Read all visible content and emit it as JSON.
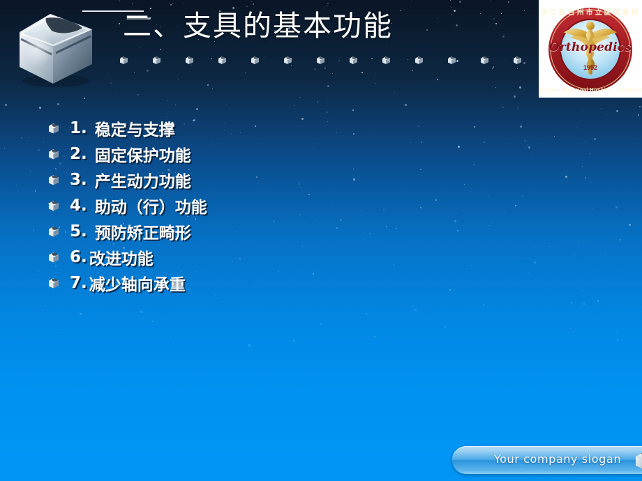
{
  "slide": {
    "title": "二、支具的基本功能",
    "background": {
      "top_color": "#0a1526",
      "bottom_color": "#0095f5",
      "accent_color": "#0671c4"
    }
  },
  "header": {
    "rule_icon": "horizontal-rule",
    "hero_icon": "chrome-cube",
    "decor_icon": "mini-cube",
    "decor_count": 13
  },
  "logo": {
    "word": "Orthopedics",
    "year": "1952",
    "arc_top": "浙江省台州市立医院骨科",
    "arc_bottom": "Taizhou Municipal Hospital · Zhejiang",
    "emblem_icon": "caduceus-icon",
    "ring_color": "#a01c22",
    "text_color": "#8d1219"
  },
  "bullets": {
    "icon": "cube-bullet-icon",
    "items": [
      {
        "num": "1.",
        "text": "稳定与支撑"
      },
      {
        "num": "2.",
        "text": "固定保护功能"
      },
      {
        "num": "3.",
        "text": "产生动力功能"
      },
      {
        "num": "4.",
        "text": "助动（行）功能"
      },
      {
        "num": "5.",
        "text": "预防矫正畸形"
      },
      {
        "num": "6.",
        "text": "改进功能"
      },
      {
        "num": "7.",
        "text": "减少轴向承重"
      }
    ]
  },
  "footer": {
    "slogan": "Your company slogan",
    "icon": "cube-icon"
  }
}
